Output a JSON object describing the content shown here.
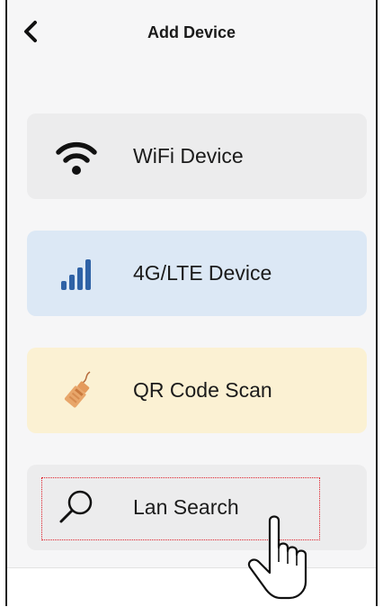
{
  "header": {
    "title": "Add Device"
  },
  "options": [
    {
      "label": "WiFi Device",
      "icon": "wifi-icon"
    },
    {
      "label": "4G/LTE Device",
      "icon": "signal-bars-icon"
    },
    {
      "label": "QR Code Scan",
      "icon": "ethernet-cable-icon"
    },
    {
      "label": "Lan Search",
      "icon": "search-icon"
    }
  ],
  "colors": {
    "wifi_card": "#ececed",
    "lte_card": "#dce8f5",
    "qr_card": "#fbf1d3",
    "lan_card": "#ececed",
    "signal_blue": "#2f62a6",
    "highlight": "#e0202a"
  }
}
